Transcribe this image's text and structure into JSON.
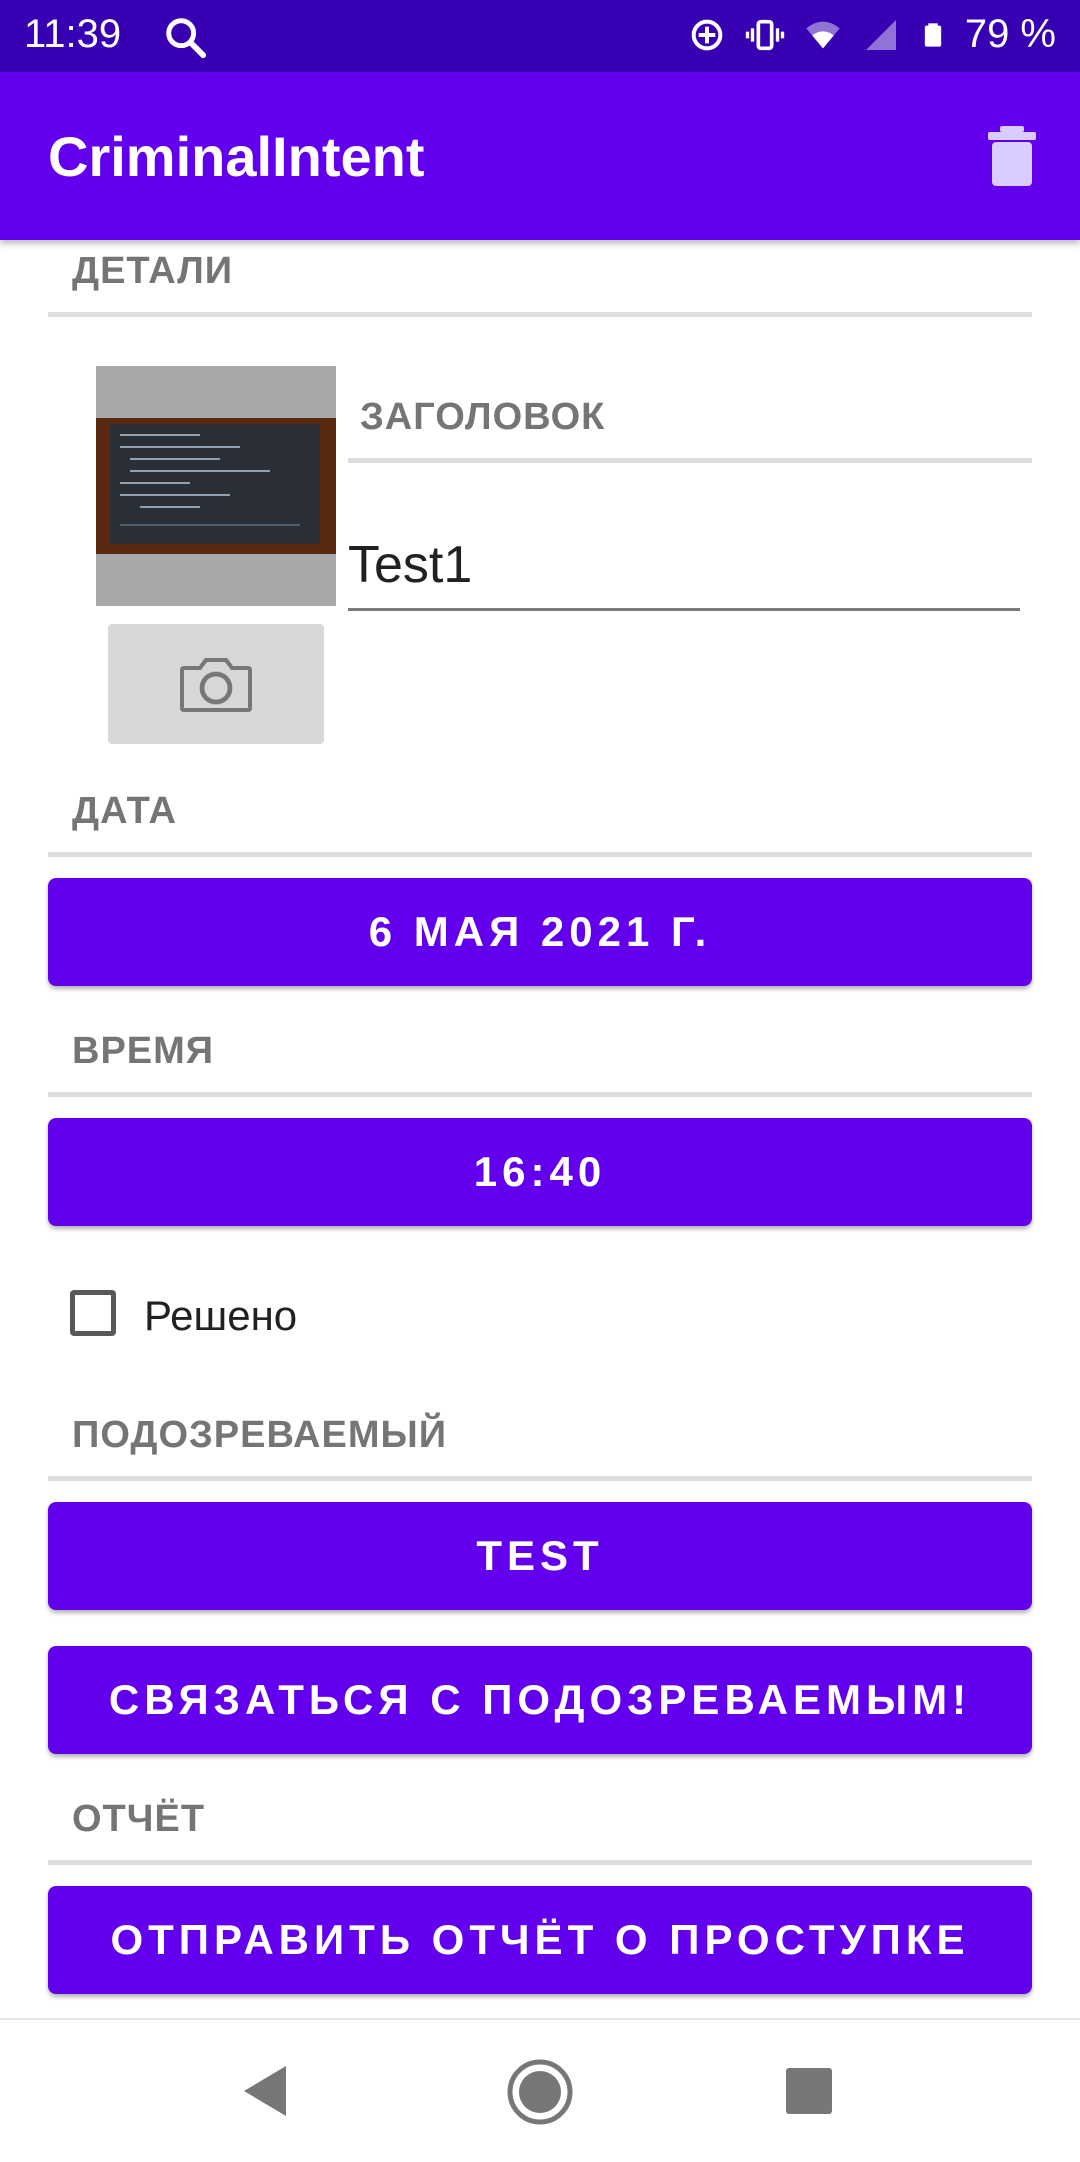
{
  "status_bar": {
    "time": "11:39",
    "battery": "79 %",
    "icons": [
      "search-icon",
      "location-icon",
      "vibrate-icon",
      "wifi-icon",
      "signal-icon",
      "battery-icon"
    ]
  },
  "app_bar": {
    "title": "CriminalIntent",
    "delete_icon": "trash-icon"
  },
  "details": {
    "section_label": "ДЕТАЛИ",
    "title_label": "ЗАГОЛОВОК",
    "title_value": "Test1",
    "camera_icon": "camera-icon"
  },
  "date": {
    "section_label": "ДАТА",
    "button_label": "6 МАЯ 2021 Г."
  },
  "time": {
    "section_label": "ВРЕМЯ",
    "button_label": "16:40"
  },
  "solved": {
    "label": "Решено",
    "checked": false
  },
  "suspect": {
    "section_label": "ПОДОЗРЕВАЕМЫЙ",
    "choose_button_label": "TEST",
    "contact_button_label": "СВЯЗАТЬСЯ С ПОДОЗРЕВАЕМЫМ!"
  },
  "report": {
    "section_label": "ОТЧЁТ",
    "send_button_label": "ОТПРАВИТЬ ОТЧЁТ О ПРОСТУПКЕ"
  },
  "colors": {
    "primary": "#6200ee",
    "primary_dark": "#3700b3",
    "label_gray": "#757575"
  }
}
